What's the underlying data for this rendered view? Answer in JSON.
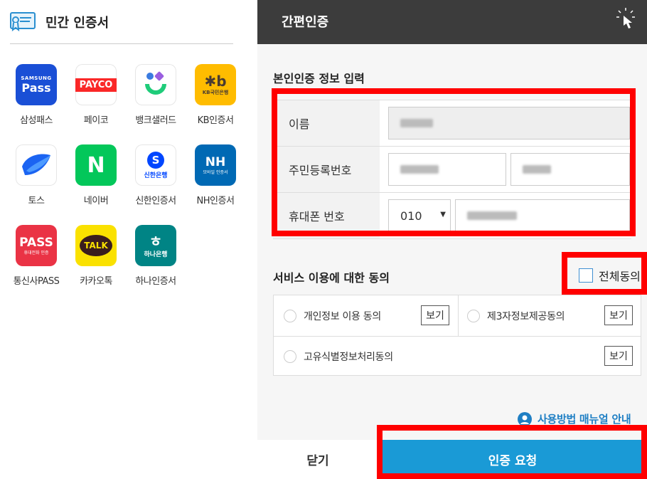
{
  "left": {
    "title": "민간 인증서",
    "apps": [
      {
        "label": "삼성패스",
        "icon": "samsung-pass-icon",
        "line1": "SAMSUNG",
        "line2": "Pass",
        "bg": "#1a4fd6"
      },
      {
        "label": "페이코",
        "icon": "payco-icon",
        "line1": "PAYCO",
        "bg": "#ffffff"
      },
      {
        "label": "뱅크샐러드",
        "icon": "banksalad-icon",
        "bg": "#ffffff"
      },
      {
        "label": "KB인증서",
        "icon": "kb-icon",
        "line1": "KB국민은행",
        "bg": "#ffbc00"
      },
      {
        "label": "토스",
        "icon": "toss-icon",
        "bg": "#ffffff"
      },
      {
        "label": "네이버",
        "icon": "naver-icon",
        "line1": "N",
        "bg": "#03c75a"
      },
      {
        "label": "신한인증서",
        "icon": "shinhan-icon",
        "line1": "S",
        "line2": "신한은행",
        "bg": "#ffffff"
      },
      {
        "label": "NH인증서",
        "icon": "nh-icon",
        "line1": "NH",
        "line2": "모바일 인증서",
        "bg": "#0069b4"
      },
      {
        "label": "통신사PASS",
        "icon": "pass-icon",
        "line1": "PASS",
        "line2": "휴대전화 인증",
        "bg": "#ea3345"
      },
      {
        "label": "카카오톡",
        "icon": "kakaotalk-icon",
        "line1": "TALK",
        "bg": "#fae100"
      },
      {
        "label": "하나인증서",
        "icon": "hana-icon",
        "line1": "하나은행",
        "bg": "#008485"
      }
    ]
  },
  "right": {
    "title": "간편인증",
    "identity_section_title": "본인인증 정보 입력",
    "form": {
      "name_label": "이름",
      "rrn_label": "주민등록번호",
      "phone_label": "휴대폰 번호",
      "phone_prefix": "010"
    },
    "consent_section_title": "서비스 이용에 대한 동의",
    "agree_all_label": "전체동의",
    "terms": [
      {
        "label": "개인정보 이용 동의",
        "view": "보기"
      },
      {
        "label": "제3자정보제공동의",
        "view": "보기"
      },
      {
        "label": "고유식별정보처리동의",
        "view": "보기"
      }
    ],
    "manual_link": "사용방법 매뉴얼 안내",
    "close_button": "닫기",
    "request_button": "인증 요청"
  },
  "colors": {
    "header_bg": "#3c3c3c",
    "primary_blue": "#1a9ad6",
    "highlight_red": "#ff0000"
  }
}
